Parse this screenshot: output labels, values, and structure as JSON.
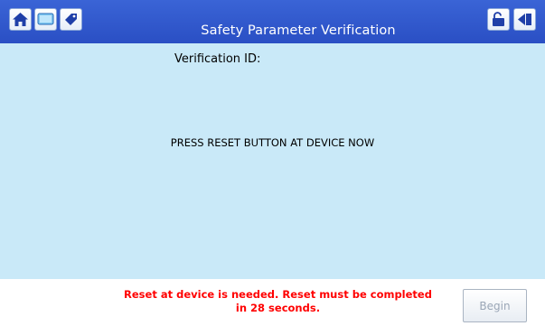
{
  "header": {
    "title": "Safety Parameter Verification",
    "left_icons": [
      "home-icon",
      "screen-icon",
      "tag-icon"
    ],
    "right_icons": [
      "lock-icon",
      "back-icon"
    ],
    "colors": {
      "bar": "#2f56cc",
      "background": "#c9e9f8"
    }
  },
  "content": {
    "verification_label": "Verification ID:",
    "verification_value": "",
    "instruction": "PRESS RESET BUTTON AT DEVICE NOW"
  },
  "footer": {
    "warning_line1": "Reset at device is needed. Reset must be completed",
    "warning_line2": "in 28 seconds.",
    "begin_label": "Begin",
    "begin_enabled": false,
    "warning_color": "#ff0000"
  }
}
